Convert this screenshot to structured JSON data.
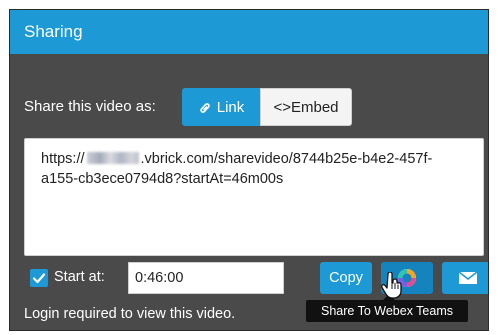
{
  "dialog": {
    "title": "Sharing"
  },
  "share": {
    "label": "Share this video as:",
    "link_label": "Link",
    "embed_label": "<>Embed"
  },
  "url": {
    "prefix": "https://",
    "suffix": ".vbrick.com/sharevideo/8744b25e-b4e2-457f-a155-cb3ece0794d8?startAt=46m00s"
  },
  "start_at": {
    "checked": true,
    "label": "Start at:",
    "value": "0:46:00"
  },
  "buttons": {
    "copy_label": "Copy",
    "webex_icon": "webex-teams-icon",
    "email_icon": "email-icon"
  },
  "footer": {
    "login_note": "Login required to view this video."
  },
  "tooltip": {
    "text": "Share To Webex Teams"
  },
  "colors": {
    "accent": "#1d9ad6",
    "panel": "#4a4a4a",
    "tooltip": "#111111"
  }
}
